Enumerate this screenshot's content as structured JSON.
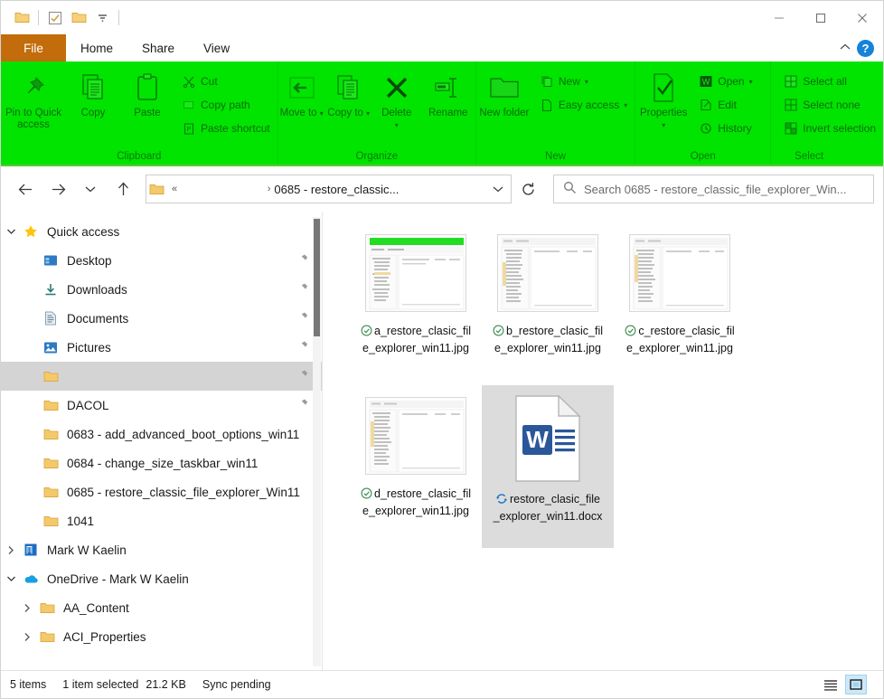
{
  "titlebar": {
    "quick_access": [
      {
        "name": "folder-icon",
        "label": "Folder"
      },
      {
        "name": "properties-checkbox-icon",
        "label": "Properties"
      },
      {
        "name": "new-folder-icon",
        "label": "New folder"
      },
      {
        "name": "customize-dropdown-icon",
        "label": "Customize Quick Access Toolbar"
      }
    ],
    "minimize_label": "Minimize",
    "maximize_label": "Maximize",
    "close_label": "Close"
  },
  "tabs": [
    {
      "label": "File",
      "active": false,
      "kind": "file"
    },
    {
      "label": "Home",
      "active": true,
      "kind": "normal"
    },
    {
      "label": "Share",
      "active": false,
      "kind": "normal"
    },
    {
      "label": "View",
      "active": false,
      "kind": "normal"
    }
  ],
  "tabs_right": {
    "collapse_label": "Collapse the Ribbon",
    "help_label": "?"
  },
  "ribbon": {
    "highlight_color": "#00e400",
    "groups": [
      {
        "label": "Clipboard",
        "big_buttons": [
          {
            "label": "Pin to Quick access",
            "icon": "pin-icon"
          },
          {
            "label": "Copy",
            "icon": "copy-icon"
          },
          {
            "label": "Paste",
            "icon": "paste-icon"
          }
        ],
        "small_buttons": [
          {
            "label": "Cut",
            "icon": "scissors-icon"
          },
          {
            "label": "Copy path",
            "icon": "copy-path-icon"
          },
          {
            "label": "Paste shortcut",
            "icon": "paste-shortcut-icon"
          }
        ]
      },
      {
        "label": "Organize",
        "big_buttons": [
          {
            "label": "Move to",
            "icon": "move-to-icon",
            "caret": true
          },
          {
            "label": "Copy to",
            "icon": "copy-to-icon",
            "caret": true
          },
          {
            "label": "Delete",
            "icon": "delete-icon",
            "caret": true
          },
          {
            "label": "Rename",
            "icon": "rename-icon"
          }
        ],
        "small_buttons": []
      },
      {
        "label": "New",
        "big_buttons": [
          {
            "label": "New folder",
            "icon": "new-folder-icon"
          }
        ],
        "small_buttons": [
          {
            "label": "New",
            "icon": "new-item-icon",
            "caret": true
          },
          {
            "label": "Easy access",
            "icon": "easy-access-icon",
            "caret": true
          }
        ]
      },
      {
        "label": "Open",
        "big_buttons": [
          {
            "label": "Properties",
            "icon": "properties-icon",
            "caret": true
          }
        ],
        "small_buttons": [
          {
            "label": "Open",
            "icon": "word-open-icon",
            "caret": true
          },
          {
            "label": "Edit",
            "icon": "edit-icon"
          },
          {
            "label": "History",
            "icon": "history-icon"
          }
        ]
      },
      {
        "label": "Select",
        "big_buttons": [],
        "small_buttons": [
          {
            "label": "Select all",
            "icon": "select-all-icon"
          },
          {
            "label": "Select none",
            "icon": "select-none-icon"
          },
          {
            "label": "Invert selection",
            "icon": "invert-selection-icon"
          }
        ]
      }
    ]
  },
  "addressbar": {
    "back_label": "Back",
    "forward_label": "Forward",
    "recent_label": "Recent locations",
    "up_label": "Up",
    "breadcrumb_overflow": "«",
    "breadcrumb_separator": "›",
    "path_text": "0685 - restore_classic...",
    "dropdown_label": "Previous locations",
    "refresh_label": "Refresh",
    "search_placeholder": "Search 0685 - restore_classic_file_explorer_Win...",
    "search_value": ""
  },
  "sidebar": {
    "items": [
      {
        "label": "Quick access",
        "icon": "star-icon",
        "expander": "down",
        "indent": 0,
        "pinned": false,
        "selected": false
      },
      {
        "label": "Desktop",
        "icon": "desktop-icon",
        "expander": "",
        "indent": 1,
        "pinned": true,
        "selected": false
      },
      {
        "label": "Downloads",
        "icon": "downloads-icon",
        "expander": "",
        "indent": 1,
        "pinned": true,
        "selected": false
      },
      {
        "label": "Documents",
        "icon": "documents-icon",
        "expander": "",
        "indent": 1,
        "pinned": true,
        "selected": false
      },
      {
        "label": "Pictures",
        "icon": "pictures-icon",
        "expander": "",
        "indent": 1,
        "pinned": true,
        "selected": false
      },
      {
        "label": "",
        "icon": "folder-icon",
        "expander": "",
        "indent": 1,
        "pinned": true,
        "selected": true
      },
      {
        "label": "DACOL",
        "icon": "folder-icon",
        "expander": "",
        "indent": 1,
        "pinned": true,
        "selected": false
      },
      {
        "label": "0683 - add_advanced_boot_options_win11",
        "icon": "folder-icon",
        "expander": "",
        "indent": 1,
        "pinned": false,
        "selected": false
      },
      {
        "label": "0684 - change_size_taskbar_win11",
        "icon": "folder-icon",
        "expander": "",
        "indent": 1,
        "pinned": false,
        "selected": false
      },
      {
        "label": "0685 - restore_classic_file_explorer_Win11",
        "icon": "folder-icon",
        "expander": "",
        "indent": 1,
        "pinned": false,
        "selected": false
      },
      {
        "label": "1041",
        "icon": "folder-icon",
        "expander": "",
        "indent": 1,
        "pinned": false,
        "selected": false
      },
      {
        "label": "Mark W Kaelin",
        "icon": "business-icon",
        "expander": "right",
        "indent": 0,
        "pinned": false,
        "selected": false
      },
      {
        "label": "OneDrive - Mark W Kaelin",
        "icon": "onedrive-icon",
        "expander": "down",
        "indent": 0,
        "pinned": false,
        "selected": false
      },
      {
        "label": "AA_Content",
        "icon": "folder-icon",
        "expander": "right",
        "indent": 1,
        "pinned": false,
        "selected": false
      },
      {
        "label": "ACI_Properties",
        "icon": "folder-icon",
        "expander": "right",
        "indent": 1,
        "pinned": false,
        "selected": false
      }
    ]
  },
  "files": [
    {
      "name": "a_restore_clasic_file_explorer_win11.jpg",
      "type": "image",
      "sync": "available-offline-icon",
      "selected": false,
      "thumb": "explorer-green-banner"
    },
    {
      "name": "b_restore_clasic_file_explorer_win11.jpg",
      "type": "image",
      "sync": "available-offline-icon",
      "selected": false,
      "thumb": "explorer-plain"
    },
    {
      "name": "c_restore_clasic_file_explorer_win11.jpg",
      "type": "image",
      "sync": "available-offline-icon",
      "selected": false,
      "thumb": "explorer-plain"
    },
    {
      "name": "d_restore_clasic_file_explorer_win11.jpg",
      "type": "image",
      "sync": "available-offline-icon",
      "selected": false,
      "thumb": "explorer-plain"
    },
    {
      "name": "restore_clasic_file_explorer_win11.docx",
      "type": "word",
      "sync": "syncing-icon",
      "selected": true,
      "thumb": "word-doc"
    }
  ],
  "statusbar": {
    "item_count": "5 items",
    "selection": "1 item selected",
    "size": "21.2 KB",
    "sync_status": "Sync pending",
    "details_view_label": "Details view",
    "large_icons_view_label": "Large icons view"
  }
}
